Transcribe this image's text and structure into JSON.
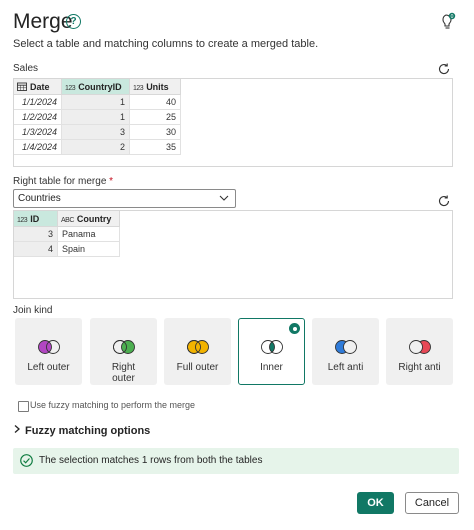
{
  "dialog": {
    "title": "Merge",
    "subtitle": "Select a table and matching columns to create a merged table."
  },
  "left_table": {
    "name": "Sales",
    "columns": [
      {
        "label": "Date",
        "type_icon": "calendar-icon"
      },
      {
        "label": "CountryID",
        "type_icon": "123"
      },
      {
        "label": "Units",
        "type_icon": "123"
      }
    ],
    "rows": [
      [
        "1/1/2024",
        "1",
        "40"
      ],
      [
        "1/2/2024",
        "1",
        "25"
      ],
      [
        "1/3/2024",
        "3",
        "30"
      ],
      [
        "1/4/2024",
        "2",
        "35"
      ]
    ]
  },
  "right_table": {
    "label": "Right table for merge",
    "required_mark": "*",
    "selected": "Countries",
    "columns": [
      {
        "label": "ID",
        "type_icon": "123"
      },
      {
        "label": "Country",
        "type_icon": "ABC"
      }
    ],
    "rows": [
      [
        "3",
        "Panama"
      ],
      [
        "4",
        "Spain"
      ]
    ]
  },
  "join_kind": {
    "label": "Join kind",
    "options": [
      {
        "label": "Left outer",
        "color": "#b146c2",
        "selected": false
      },
      {
        "label": "Right outer",
        "color": "#4caf50",
        "selected": false
      },
      {
        "label": "Full outer",
        "color": "#f2b300",
        "selected": false
      },
      {
        "label": "Inner",
        "color": "#117865",
        "selected": true
      },
      {
        "label": "Left anti",
        "color": "#2f7bd9",
        "selected": false
      },
      {
        "label": "Right anti",
        "color": "#e74856",
        "selected": false
      }
    ]
  },
  "fuzzy": {
    "checkbox_label": "Use fuzzy matching to perform the merge",
    "options_label": "Fuzzy matching options"
  },
  "status": {
    "message": "The selection matches 1 rows from both the tables"
  },
  "buttons": {
    "ok": "OK",
    "cancel": "Cancel"
  },
  "colors": {
    "accent": "#117865",
    "selected_header": "#c9e8de",
    "success_bg": "#e6f4ea"
  }
}
